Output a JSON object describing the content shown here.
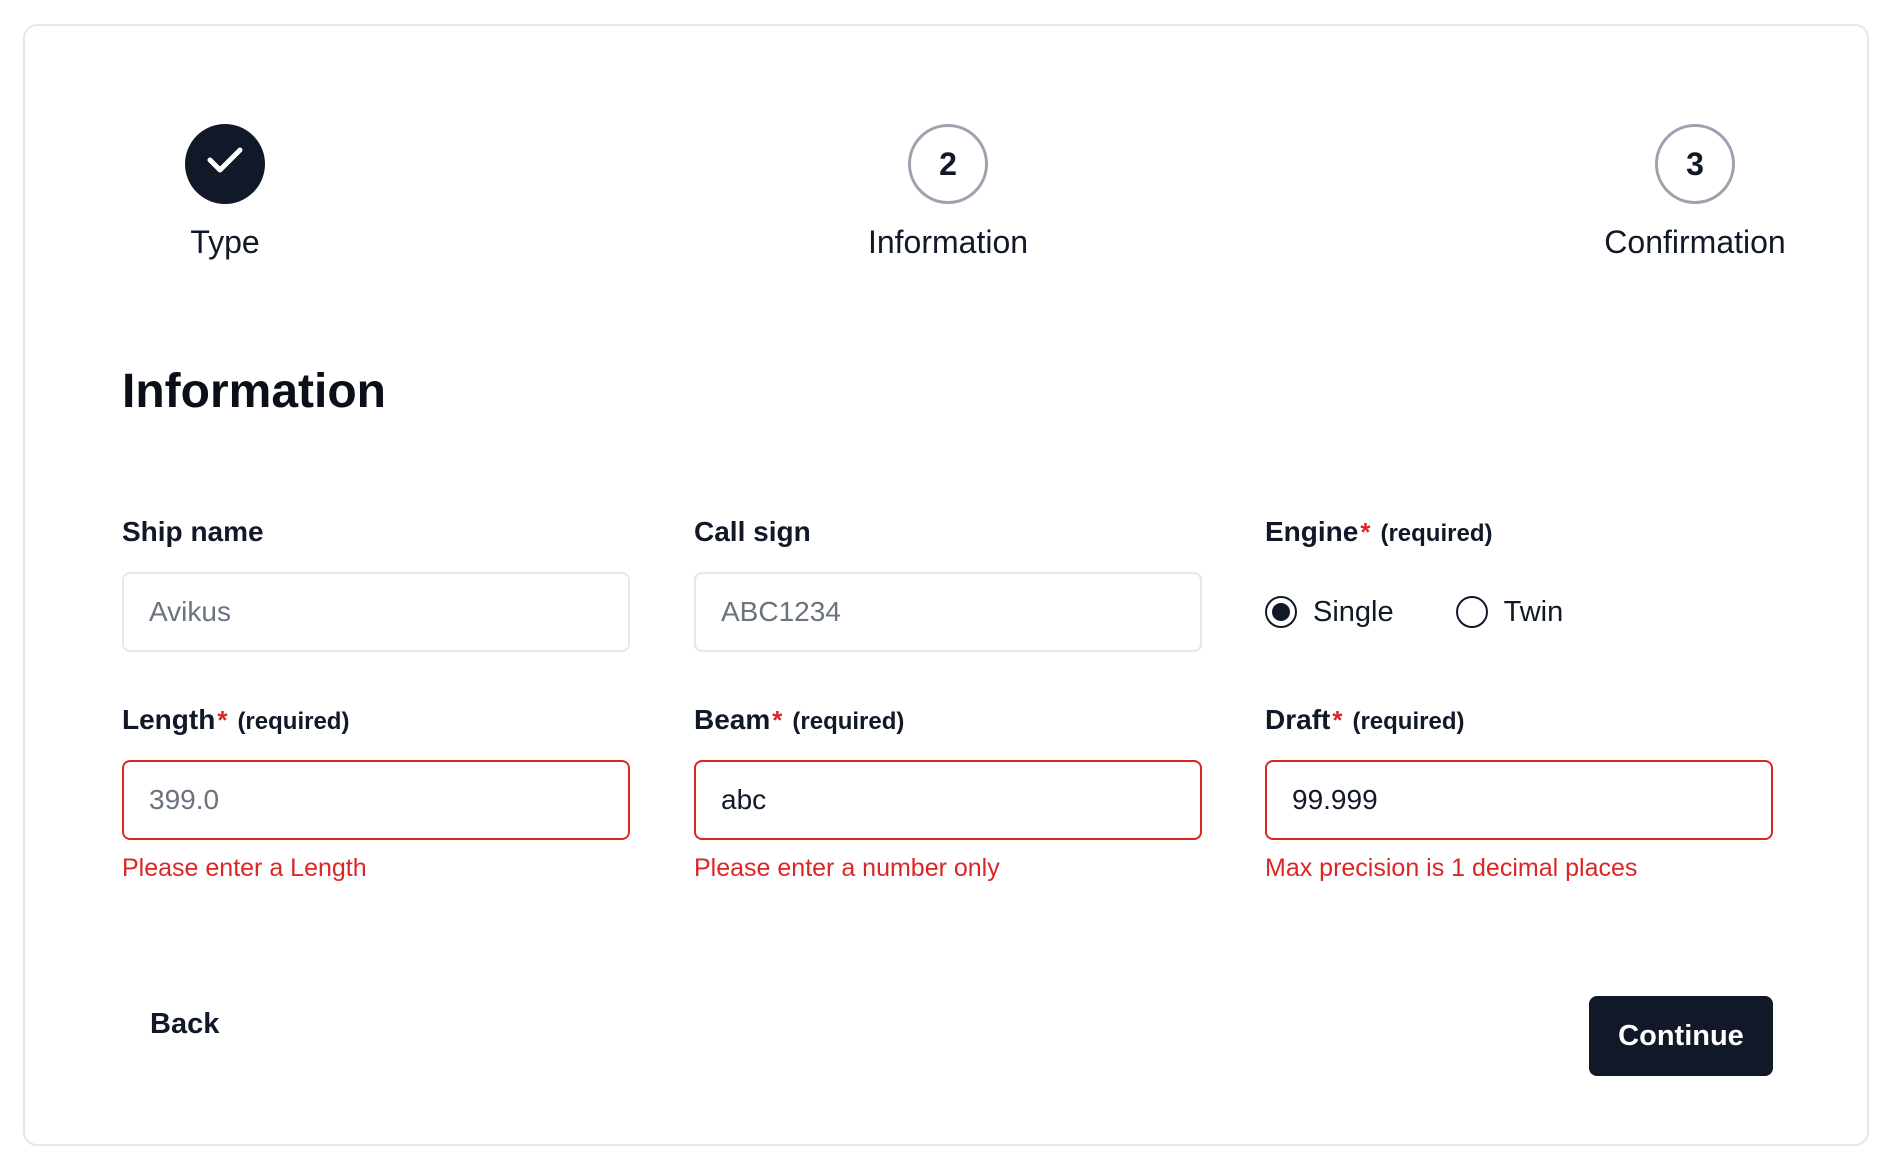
{
  "stepper": {
    "steps": [
      {
        "number": "",
        "label": "Type",
        "status": "complete",
        "icon": "check-icon"
      },
      {
        "number": "2",
        "label": "Information",
        "status": "current"
      },
      {
        "number": "3",
        "label": "Confirmation",
        "status": "upcoming"
      }
    ]
  },
  "section": {
    "title": "Information"
  },
  "fields": {
    "ship_name": {
      "label": "Ship name",
      "placeholder": "Avikus"
    },
    "call_sign": {
      "label": "Call sign",
      "placeholder": "ABC1234"
    },
    "engine": {
      "label": "Engine",
      "required_mark": "*",
      "required_note": "(required)",
      "options": [
        "Single",
        "Twin"
      ],
      "selected": "Single"
    },
    "length": {
      "label": "Length",
      "required_mark": "*",
      "required_note": "(required)",
      "placeholder": "399.0",
      "value": "",
      "error": "Please enter a Length"
    },
    "beam": {
      "label": "Beam",
      "required_mark": "*",
      "required_note": "(required)",
      "value": "abc",
      "error": "Please enter a number only"
    },
    "draft": {
      "label": "Draft",
      "required_mark": "*",
      "required_note": "(required)",
      "value": "99.999",
      "error": "Max precision is 1 decimal places"
    }
  },
  "actions": {
    "back_label": "Back",
    "continue_label": "Continue"
  },
  "colors": {
    "primary": "#111827",
    "error": "#dc2626",
    "border": "#e5e7eb",
    "muted_border": "#9ca3af",
    "placeholder": "#6b7280"
  }
}
